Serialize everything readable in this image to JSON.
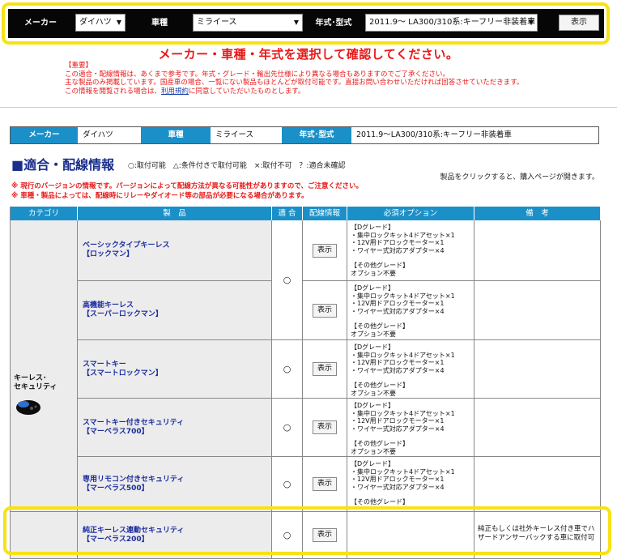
{
  "selector": {
    "maker_label": "メーカー",
    "maker_value": "ダイハツ",
    "model_label": "車種",
    "model_value": "ミライース",
    "year_label": "年式･型式",
    "year_value": "2011.9～ LA300/310系:キーフリー非装着車",
    "show_button": "表示"
  },
  "headline": "メーカー・車種・年式を選択して確認してください。",
  "notice": {
    "title": "【重要】",
    "line1": "この適合・配線情報は、あくまで参考です。年式・グレード・輸出先仕様により異なる場合もありますのでご了承ください。",
    "line2": "主な製品のみ掲載しています。国産車の場合、一覧にない製品もほとんどが取付可能です。直接お問い合わせいただければ回答させていただきます。",
    "line3_pre": "この情報を閲覧される場合は、",
    "line3_link": "利用規約",
    "line3_post": "に同意していただいたものとします。"
  },
  "info": {
    "maker_label": "メーカー",
    "maker_value": "ダイハツ",
    "model_label": "車種",
    "model_value": "ミライース",
    "year_label": "年式･型式",
    "year_value": "2011.9～LA300/310系:キーフリー非装着車"
  },
  "section_title": "■適合・配線情報",
  "legend": "○:取付可能　△:条件付きで取付可能　×:取付不可　？:適合未確認",
  "click_note": "製品をクリックすると、購入ページが開きます。",
  "warnings": [
    "※ 現行のバージョンの情報です。バージョンによって配線方法が異なる可能性がありますので、ご注意ください。",
    "※ 車種・製品によっては、配線時にリレーやダイオード等の部品が必要になる場合があります。"
  ],
  "table": {
    "headers": [
      "カテゴリ",
      "製　品",
      "適 合",
      "配線情報",
      "必須オプション",
      "備　考"
    ],
    "category": "キーレス･\nセキュリティ",
    "option_lines": [
      "【Dグレード】",
      "・集中ロックキット4ドアセット×1",
      "・12V用ドアロックモーター×1",
      "・ワイヤー式対応アダプター×4",
      "",
      "【その他グレード】",
      "オプション不要"
    ],
    "rows": [
      {
        "name1": "ベーシックタイプキーレス",
        "name2": "【ロックマン】",
        "fit": "○",
        "button": "表示",
        "remark": ""
      },
      {
        "name1": "高機能キーレス",
        "name2": "【スーパーロックマン】",
        "fit": "○",
        "button": "表示",
        "remark": ""
      },
      {
        "name1": "スマートキー",
        "name2": "【スマートロックマン】",
        "fit": "○",
        "button": "表示",
        "remark": ""
      },
      {
        "name1": "スマートキー付きセキュリティ",
        "name2": "【マーベラス700】",
        "fit": "○",
        "button": "表示",
        "remark": ""
      },
      {
        "name1": "専用リモコン付きセキュリティ",
        "name2": "【マーベラス500】",
        "fit": "○",
        "button": "表示",
        "remark": ""
      },
      {
        "name1": "純正キーレス連動セキュリティ",
        "name2": "【マーベラス200】",
        "fit": "○",
        "button": "表示",
        "remark": "純正もしくは社外キーレス付き車でハザードアンサーバックする車に取付可"
      }
    ]
  }
}
